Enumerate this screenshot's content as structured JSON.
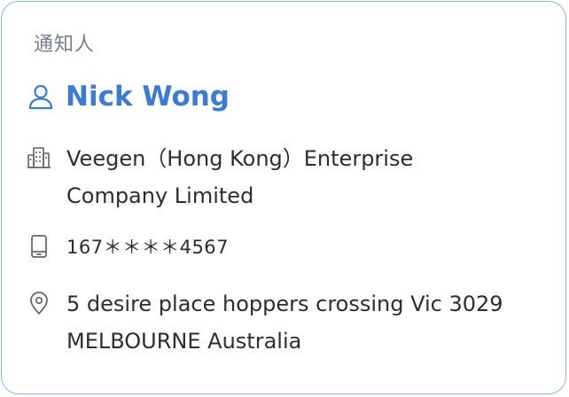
{
  "card": {
    "section_label": "通知人",
    "contact_name": "Nick Wong",
    "company_lines": [
      "Veegen（Hong Kong）Enterprise",
      "Company Limited"
    ],
    "phone": "167＊＊＊＊4567",
    "address_lines": [
      "5 desire place hoppers crossing Vic 3029",
      "MELBOURNE Australia"
    ]
  },
  "icons": {
    "person": "person-outline-icon",
    "company": "building-icon",
    "phone": "mobile-phone-icon",
    "address": "location-pin-icon"
  },
  "colors": {
    "accent": "#3a7bd5",
    "border": "#8fb3e6",
    "label": "#7a7f87",
    "text": "#2b2d31",
    "icon": "#5f6368"
  }
}
